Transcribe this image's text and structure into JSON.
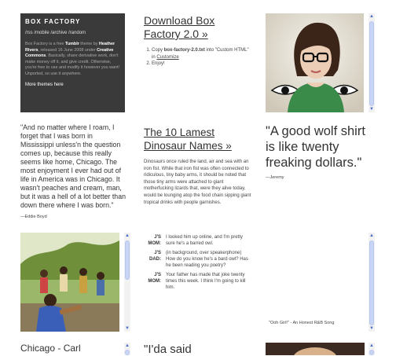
{
  "infobox": {
    "logo": "BOX FACTORY",
    "nav": "/rss  /mobile  /archive  /random",
    "desc_1": "Box Factory is a free ",
    "desc_tumblr": "Tumblr",
    "desc_2": " theme by ",
    "desc_author": "Heather Rivers",
    "desc_3": ", released 16 June 2008 under ",
    "desc_cc": "Creative Commons",
    "desc_4": ". Basically, share derivative work, don't make money off it, and give credit. Otherwise, you're free to use and modify it however you want! Unported, so use it anywhere.",
    "more": "More themes here"
  },
  "download": {
    "title": "Download Box Factory 2.0 »",
    "step1_a": "Copy ",
    "step1_file": "box-factory-2.0.txt",
    "step1_b": " into \"Custom HTML\" in ",
    "step1_link": "Customize",
    "step2": "Enjoy!"
  },
  "quote1": {
    "text": "\"And no matter where I roam, I forget that I was born in Mississippi unless'n the question comes up, because this really seems like home, Chicago. The most enjoyment I ever had out of life in America was in Chicago. It wasn't peaches and cream, man, but it was a hell of a lot better than down there where I was born.\"",
    "attrib": "—Eddie Boyd"
  },
  "dino": {
    "title": "The 10 Lamest Dinosaur Names »",
    "body": "Dinosaurs once ruled the land, air and sea with an iron fist. While that iron fist was often connected to ridiculous, tiny baby arms, it should be noted that those tiny arms were attached to giant motherfucking lizards that, were they alive today, would be lounging atop the food chain sipping giant tropical drinks with people garnishes."
  },
  "quote2": {
    "text": "\"A good wolf shirt is like twenty freaking dollars.\"",
    "attrib": "—Jeremy"
  },
  "chat": [
    {
      "name": "J'S MOM:",
      "msg": "I looked him up online, and I'm pretty sure he's a barred owl."
    },
    {
      "name": "J'S DAD:",
      "msg": "(in background, over speakerphone) How do you know he's a bard owl? Has he been reading you poetry?"
    },
    {
      "name": "J'S MOM:",
      "msg": "Your father has made that joke twenty times this week. I think I'm going to kill him."
    }
  ],
  "audio": {
    "caption": "\"Ooh Girl!\" - An Honest R&B Song"
  },
  "bottom": {
    "chicago": "Chicago - Carl",
    "quote": "\"I'da said"
  },
  "colors": {
    "infobox_bg": "#3a3a3a",
    "scroll_thumb": "#c9d5f5",
    "scroll_arrow": "#4a6fc7"
  }
}
